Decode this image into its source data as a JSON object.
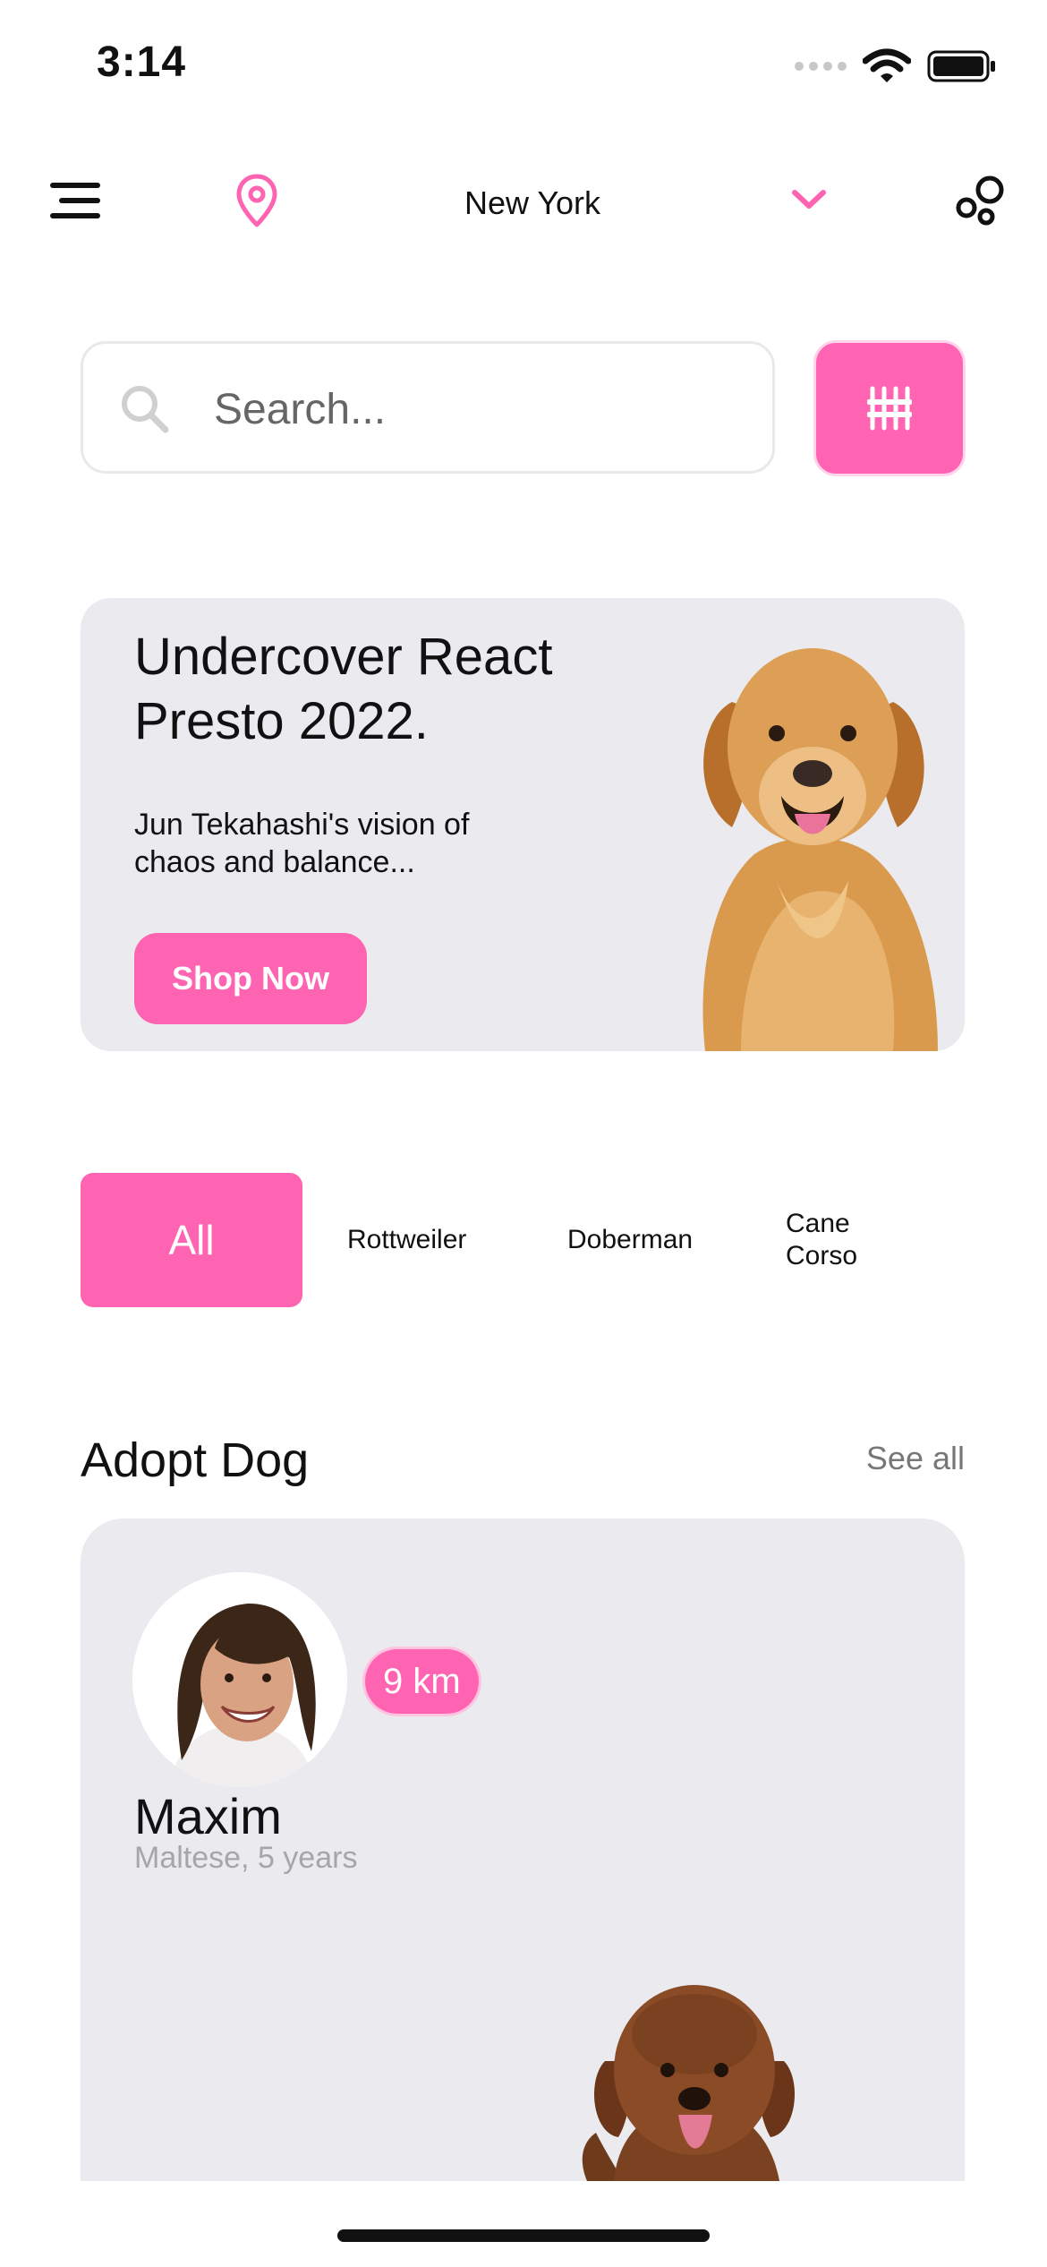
{
  "status_bar": {
    "time": "3:14"
  },
  "header": {
    "city": "New York",
    "menu_icon": "menu-icon",
    "location_icon": "map-pin-icon",
    "dropdown_icon": "chevron-down-icon",
    "settings_icon": "circles-icon"
  },
  "search": {
    "placeholder": "Search..."
  },
  "promo": {
    "title": "Undercover React Presto 2022.",
    "subtitle": "Jun Tekahashi's vision of chaos and balance...",
    "button_label": "Shop Now"
  },
  "categories": {
    "items": [
      {
        "label": "All",
        "active": true
      },
      {
        "label": "Rottweiler",
        "active": false
      },
      {
        "label": "Doberman",
        "active": false
      },
      {
        "label": "Cane Corso",
        "active": false
      }
    ]
  },
  "adopt": {
    "section_title": "Adopt Dog",
    "see_all_label": "See all",
    "card": {
      "distance": "9 km",
      "name": "Maxim",
      "details": "Maltese, 5 years"
    }
  },
  "colors": {
    "accent": "#ff64b2",
    "card_background": "#ebebef"
  }
}
